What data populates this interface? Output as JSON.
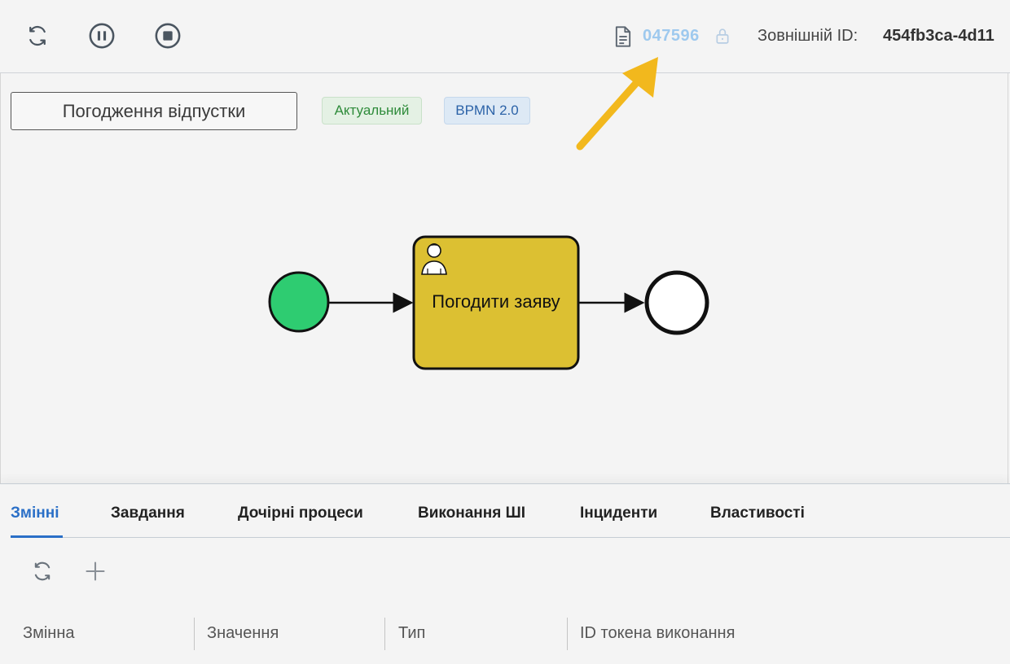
{
  "toolbar": {
    "buttons": [
      {
        "icon": "refresh-icon"
      },
      {
        "icon": "pause-icon"
      },
      {
        "icon": "stop-icon"
      }
    ],
    "instance_id": "047596",
    "external_id_label": "Зовнішній ID:",
    "external_id_value": "454fb3ca-4d11"
  },
  "process": {
    "name": "Погодження відпустки",
    "status_badge": "Актуальний",
    "format_badge": "BPMN 2.0"
  },
  "diagram": {
    "task_label": "Погодити заяву",
    "start_color": "#2ecc71",
    "task_color": "#dcc032",
    "end_color": "#ffffff"
  },
  "annotation": {
    "color": "#f2b81d"
  },
  "tabs": [
    {
      "label": "Змінні",
      "active": true
    },
    {
      "label": "Завдання"
    },
    {
      "label": "Дочірні процеси"
    },
    {
      "label": "Виконання ШІ"
    },
    {
      "label": "Інциденти"
    },
    {
      "label": "Властивості"
    }
  ],
  "table": {
    "columns": [
      "Змінна",
      "Значення",
      "Тип",
      "ID токена виконання"
    ]
  },
  "colors": {
    "accent": "#2a6fc7",
    "background": "#f4f4f4"
  }
}
